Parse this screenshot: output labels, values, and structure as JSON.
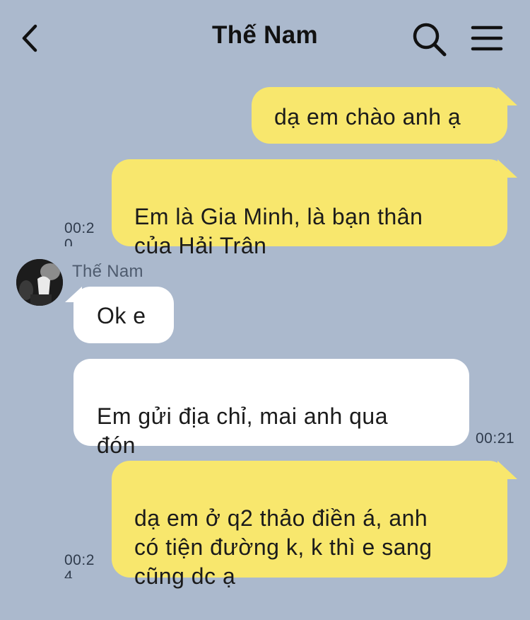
{
  "header": {
    "title": "Thế Nam",
    "back_icon": "chevron-left-icon",
    "search_icon": "search-icon",
    "menu_icon": "hamburger-menu-icon"
  },
  "colors": {
    "background": "#abb9cd",
    "outgoing_bubble": "#f8e76d",
    "incoming_bubble": "#ffffff"
  },
  "messages": [
    {
      "direction": "outgoing",
      "text": "dạ em chào anh ạ",
      "time": ""
    },
    {
      "direction": "outgoing",
      "text": "Em là Gia Minh, là bạn thân\ncủa Hải Trân",
      "time": "00:20"
    },
    {
      "direction": "incoming",
      "sender": "Thế Nam",
      "text": "Ok e",
      "time": ""
    },
    {
      "direction": "incoming",
      "text": "Em gửi địa chỉ, mai anh qua\nđón",
      "time": "00:21"
    },
    {
      "direction": "outgoing",
      "text": "dạ em ở q2 thảo điền á, anh\ncó tiện đường k, k thì e sang\ncũng dc ạ",
      "time": "00:24"
    }
  ]
}
